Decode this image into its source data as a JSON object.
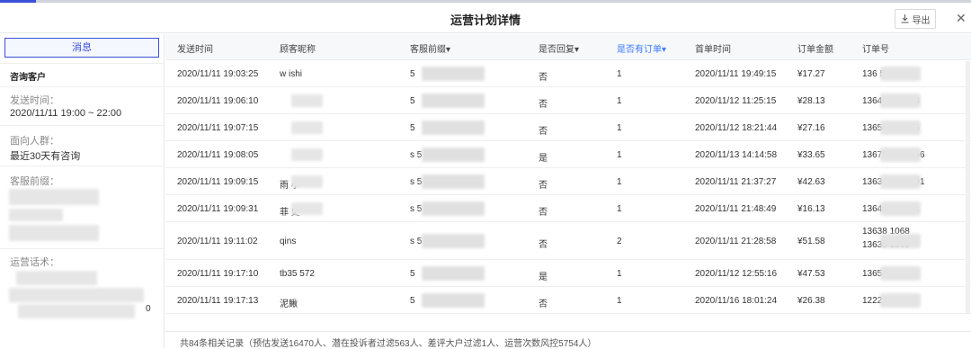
{
  "dialog": {
    "title": "运营计划详情",
    "export_label": "导出",
    "close_glyph": "✕",
    "export_icon": "download-icon"
  },
  "sidebar": {
    "message_tab": "消息",
    "customer_label": "咨询客户",
    "send_time_title": "发送时间：",
    "send_time_value": "2020/11/11 19:00 ~ 22:00",
    "audience_title": "面向人群：",
    "audience_value": "最近30天有咨询",
    "agent_title": "客服前缀：",
    "script_title": "运营话术：",
    "script_tail": "0"
  },
  "table": {
    "headers": [
      "发送时间",
      "顾客昵称",
      "客服前缀▾",
      "是否回复▾",
      "是否有订单▾",
      "首单时间",
      "订单金额",
      "订单号"
    ],
    "rows": [
      {
        "send": "2020/11/11 19:03:25",
        "nick": "w      ishi",
        "agent": "5",
        "reply": "否",
        "order": "1",
        "first": "2020/11/11 19:49:15",
        "amount": "¥17.27",
        "no": "136            530286"
      },
      {
        "send": "2020/11/11 19:06:10",
        "nick": "",
        "agent": "5",
        "reply": "否",
        "order": "1",
        "first": "2020/11/12 11:25:15",
        "amount": "¥28.13",
        "no": "13648          410363"
      },
      {
        "send": "2020/11/11 19:07:15",
        "nick": "",
        "agent": "5",
        "reply": "否",
        "order": "1",
        "first": "2020/11/12 18:21:44",
        "amount": "¥27.16",
        "no": "13655          370886"
      },
      {
        "send": "2020/11/11 19:08:05",
        "nick": "",
        "agent": "s                5",
        "reply": "是",
        "order": "1",
        "first": "2020/11/13 14:14:58",
        "amount": "¥33.65",
        "no": "136799          005256"
      },
      {
        "send": "2020/11/11 19:09:15",
        "nick": "雨       小",
        "agent": "s                5",
        "reply": "否",
        "order": "1",
        "first": "2020/11/11 21:37:27",
        "amount": "¥42.63",
        "no": "136399         456591"
      },
      {
        "send": "2020/11/11 19:09:31",
        "nick": "菲        史",
        "agent": "s                5",
        "reply": "否",
        "order": "1",
        "first": "2020/11/11 21:48:49",
        "amount": "¥16.13",
        "no": "136422          49281"
      },
      {
        "send": "2020/11/11 19:11:02",
        "nick": "qins",
        "agent": "s                5",
        "reply": "否",
        "order": "2",
        "first": "2020/11/11 21:28:58",
        "amount": "¥51.58",
        "no": "13638          1068",
        "no2": "13639          1068"
      },
      {
        "send": "2020/11/11 19:17:10",
        "nick": "tb35      572",
        "agent": "5",
        "reply": "是",
        "order": "1",
        "first": "2020/11/12 12:55:16",
        "amount": "¥47.53",
        "no": "13658          2268"
      },
      {
        "send": "2020/11/11 19:17:13",
        "nick": "泥鳅",
        "agent": "5",
        "reply": "否",
        "order": "1",
        "first": "2020/11/16 18:01:24",
        "amount": "¥26.38",
        "no": "12222          7387"
      }
    ]
  },
  "footer": {
    "summary": "共84条相关记录（预估发送16470人、潜在投诉者过滤563人、差评大户过滤1人、运营次数风控5754人）"
  },
  "colors": {
    "accent": "#3a4fd8",
    "link": "#3a7bff"
  }
}
